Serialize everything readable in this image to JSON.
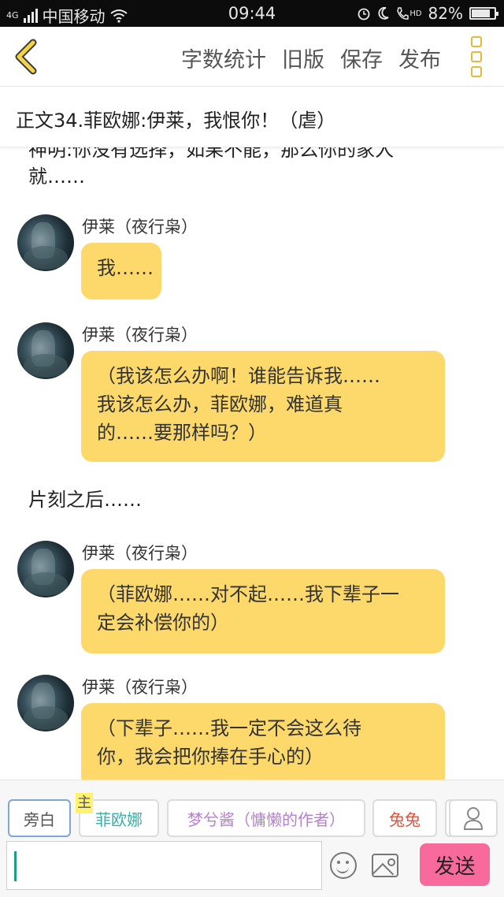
{
  "status": {
    "network": "4G",
    "carrier": "中国移动",
    "time": "09:44",
    "hd": "HD",
    "battery": "82%",
    "battery_level": 0.82
  },
  "toolbar": {
    "word_count": "字数统计",
    "old_version": "旧版",
    "save": "保存",
    "publish": "发布"
  },
  "chapter_title": "正文34.菲欧娜:伊莱，我恨你！（虐）",
  "content": {
    "top_partial": "神明:你没有选择，如果不能，那么你的家人",
    "top_line2": "就……",
    "narration": "片刻之后……",
    "messages": [
      {
        "name": "伊莱（夜行枭）",
        "lines": [
          "我……"
        ]
      },
      {
        "name": "伊莱（夜行枭）",
        "lines": [
          "（我该怎么办啊！谁能告诉我……",
          "我该怎么办，菲欧娜，难道真",
          "的……要那样吗？）"
        ]
      },
      {
        "name": "伊莱（夜行枭）",
        "lines": [
          "（菲欧娜……对不起……我下辈子一",
          "定会补偿你的）"
        ]
      },
      {
        "name": "伊莱（夜行枭）",
        "lines": [
          "（下辈子……我一定不会这么待",
          "你，我会把你捧在手心的）"
        ]
      }
    ]
  },
  "roles": {
    "narrator": "旁白",
    "main_badge": "主",
    "fiona": "菲欧娜",
    "author": "梦兮酱（慵懒的作者）",
    "tutu": "兔兔",
    "colors": {
      "fiona": "#3aaea8",
      "author": "#b77fd0",
      "tutu": "#e0533c"
    }
  },
  "input": {
    "value": ""
  },
  "send_label": "发送"
}
